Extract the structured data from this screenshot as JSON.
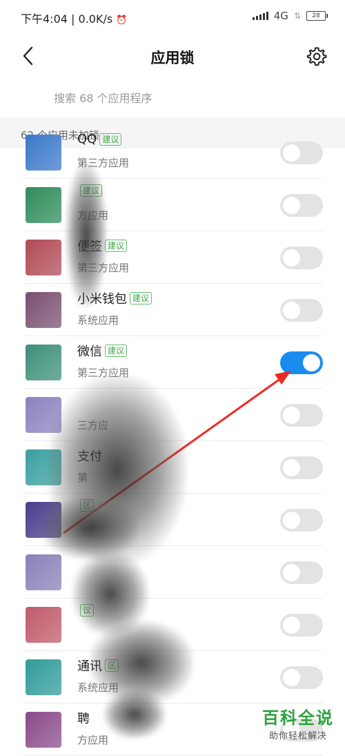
{
  "status_bar": {
    "time": "下午4:04",
    "net_speed": "0.0K/s",
    "network": "4G",
    "battery": "28"
  },
  "header": {
    "title": "应用锁"
  },
  "search": {
    "placeholder": "搜索 68 个应用程序"
  },
  "section": {
    "label": "62 个应用未加锁"
  },
  "apps": [
    {
      "name": "QQ",
      "tag": "建议",
      "type": "第三方应用",
      "locked": false,
      "icon": "qq-icon",
      "icon_color": "#3a78c9"
    },
    {
      "name": "",
      "tag": "建议",
      "type": "方应用",
      "locked": false,
      "icon": "jd-icon",
      "icon_color": "#2f8c5b"
    },
    {
      "name": "便签",
      "tag": "建议",
      "type": "第三方应用",
      "locked": false,
      "icon": "notes-icon",
      "icon_color": "#b04a55"
    },
    {
      "name": "小米钱包",
      "tag": "建议",
      "type": "系统应用",
      "locked": false,
      "icon": "wallet-icon",
      "icon_color": "#7a5070"
    },
    {
      "name": "微信",
      "tag": "建议",
      "type": "第三方应用",
      "locked": true,
      "icon": "wechat-icon",
      "icon_color": "#3d8f7a"
    },
    {
      "name": "",
      "tag": "",
      "type": "三方应",
      "locked": false,
      "icon": "app-icon",
      "icon_color": "#8a83c0"
    },
    {
      "name": "支付",
      "tag": "",
      "type": "第",
      "locked": false,
      "icon": "alipay-icon",
      "icon_color": "#3aa0a0"
    },
    {
      "name": "",
      "tag": "区",
      "type": "",
      "locked": false,
      "icon": "space-icon",
      "icon_color": "#4a3e8c"
    },
    {
      "name": "",
      "tag": "",
      "type": "",
      "locked": false,
      "icon": "app-icon",
      "icon_color": "#8b80b8"
    },
    {
      "name": "",
      "tag": "议",
      "type": "",
      "locked": false,
      "icon": "message-icon",
      "icon_color": "#c05a6a"
    },
    {
      "name": "通讯",
      "tag": "区",
      "type": "系统应用",
      "locked": false,
      "icon": "contacts-icon",
      "icon_color": "#2f9c9a"
    },
    {
      "name": "聘",
      "tag": "",
      "type": "方应用",
      "locked": false,
      "icon": "app-icon",
      "icon_color": "#8a4a8a"
    }
  ],
  "watermark": {
    "main": "百科全说",
    "sub": "助你轻松解决"
  }
}
